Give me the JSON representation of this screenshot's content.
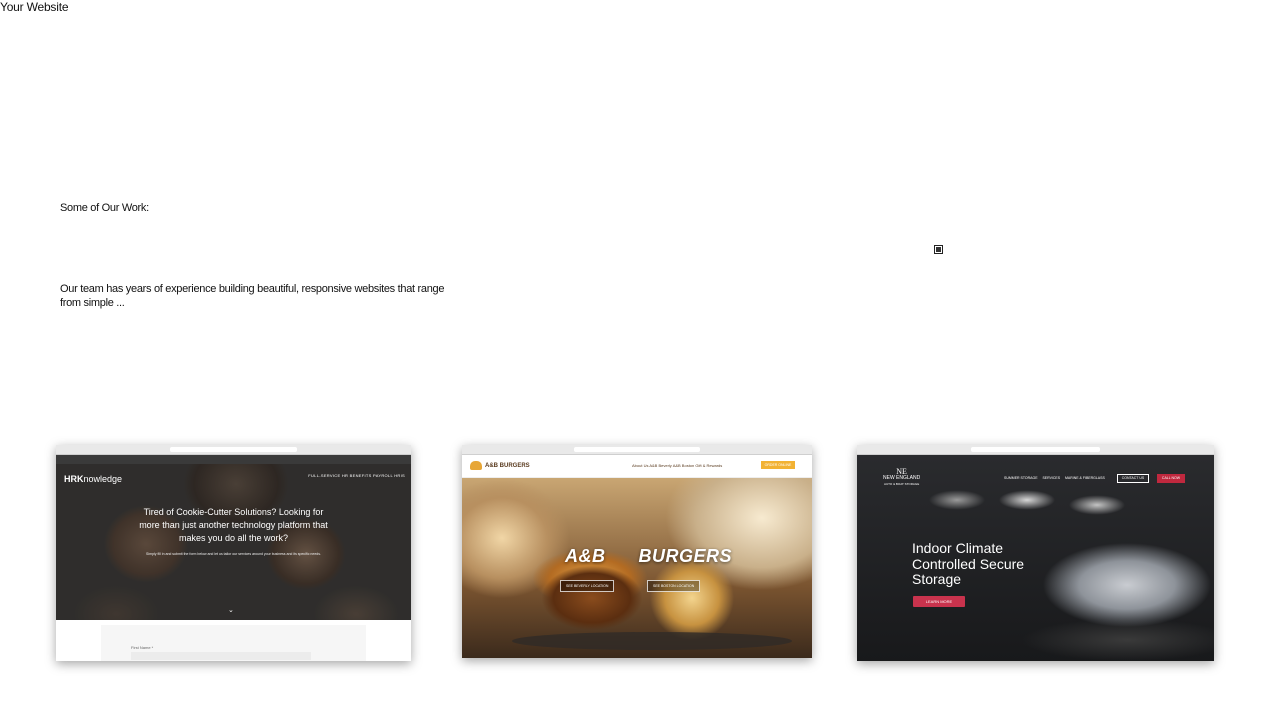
{
  "site": {
    "title": "Your Website"
  },
  "work": {
    "heading": "Some of Our Work:",
    "intro": "Our team has years of experience building beautiful, responsive websites that range from simple ..."
  },
  "portfolio": [
    {
      "brand": "HRKnowledge",
      "brand_prefix": "HRK",
      "brand_suffix": "nowledge",
      "menu": "FULL-SERVICE   HR   BENEFITS   PAYROLL   HRIS",
      "headline": "Tired of Cookie-Cutter Solutions? Looking for more than just another technology platform that makes you do all the work?",
      "subtext": "Simply fill in and submit the form below and let us tailor our services around your business and its specific needs.",
      "form_label": "First Name *"
    },
    {
      "brand": "A&B BURGERS",
      "menu": "About Us   A&B Beverly   A&B Boston   Gift & Rewards",
      "order_button": "ORDER ONLINE",
      "title": "A&B      BURGERS",
      "buttons": [
        "SEE BEVERLY LOCATION",
        "SEE BOSTON LOCATION"
      ]
    },
    {
      "brand_initials": "NE",
      "brand": "NEW ENGLAND",
      "brand_tagline": "AUTO & BOAT STORAGE",
      "menu": "SUMMER STORAGE     SERVICES     MARINE & FIBERGLASS",
      "contact_button": "CONTACT US",
      "call_button": "CALL NOW",
      "headline": "Indoor Climate Controlled Secure Storage",
      "cta": "LEARN MORE"
    }
  ],
  "colors": {
    "burger_accent": "#f2b233",
    "storage_accent": "#c9334d"
  }
}
